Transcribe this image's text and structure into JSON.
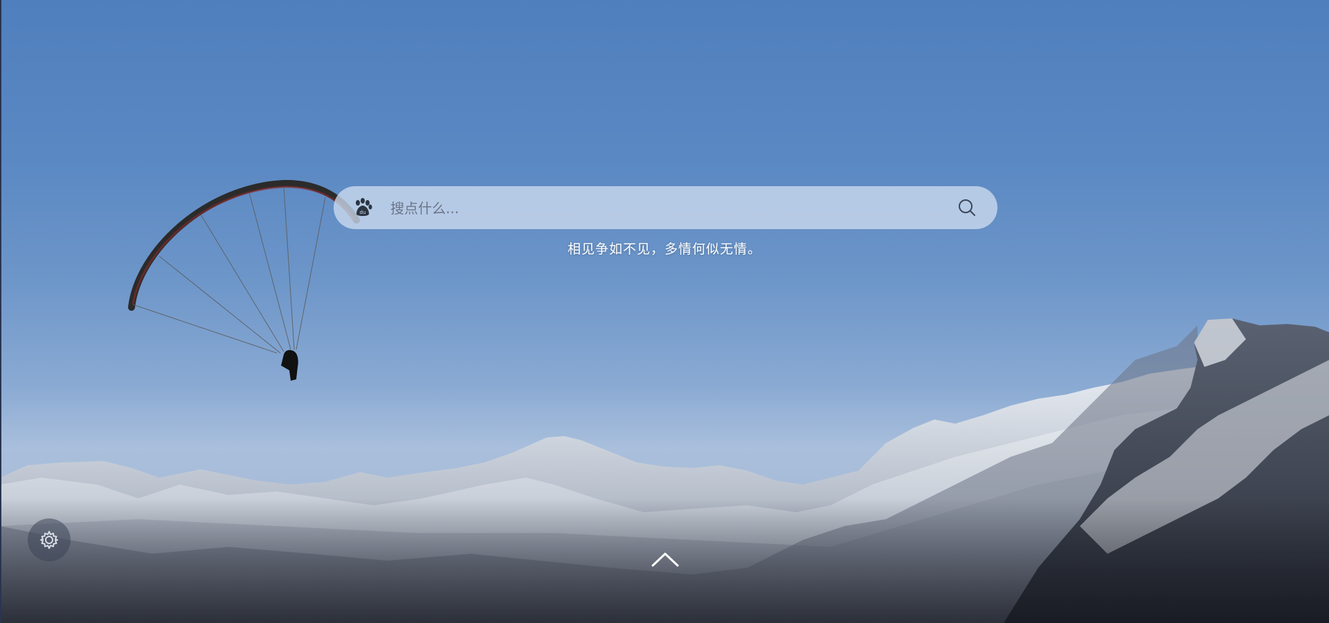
{
  "search": {
    "placeholder": "搜点什么...",
    "engine_icon": "baidu-paw-icon",
    "search_icon": "search-icon"
  },
  "quote": {
    "text": "相见争如不见，多情何似无情。"
  },
  "controls": {
    "settings_icon": "gear-icon",
    "scroll_up_icon": "chevron-up-icon"
  },
  "colors": {
    "sky_top": "#4f7fbd",
    "sky_horizon": "#a9bfdc",
    "search_bg": "#cddbee",
    "text": "#ffffff"
  }
}
